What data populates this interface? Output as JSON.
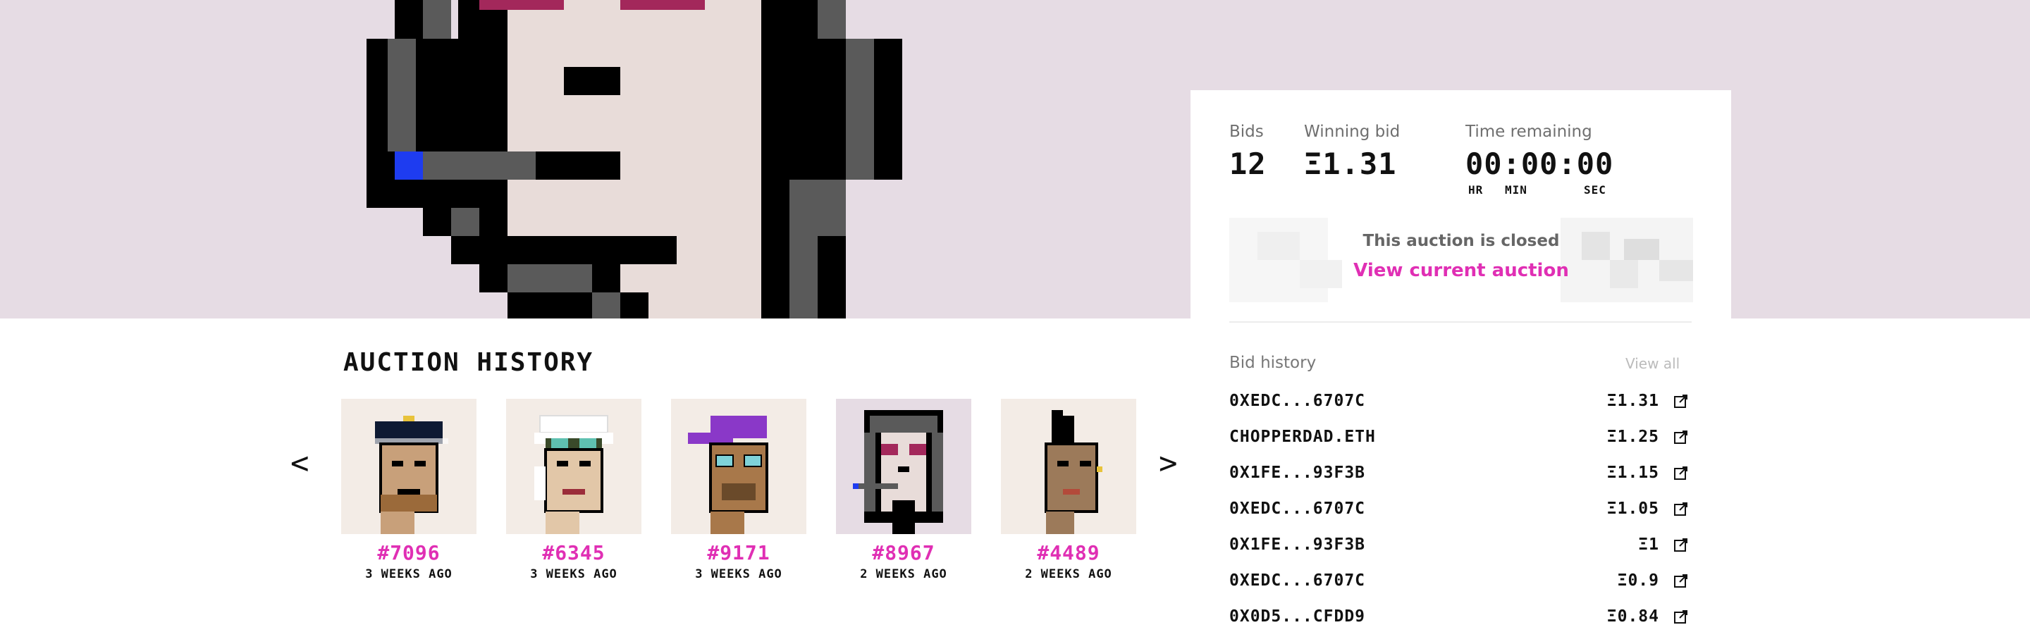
{
  "auction": {
    "bids_label": "Bids",
    "bids_value": "12",
    "winning_label": "Winning bid",
    "winning_value": "Ξ1.31",
    "time_label": "Time remaining",
    "time_value": "00:00:00",
    "units": [
      "HR",
      "MIN",
      "SEC"
    ],
    "closed_text": "This auction is closed",
    "view_current": "View current auction"
  },
  "history": {
    "title": "AUCTION HISTORY",
    "prev_label": "<",
    "next_label": ">",
    "items": [
      {
        "number": "#7096",
        "ago": "3 WEEKS AGO",
        "bg": "#f3ece6"
      },
      {
        "number": "#6345",
        "ago": "3 WEEKS AGO",
        "bg": "#f3ece6"
      },
      {
        "number": "#9171",
        "ago": "3 WEEKS AGO",
        "bg": "#f3ece6"
      },
      {
        "number": "#8967",
        "ago": "2 WEEKS AGO",
        "bg": "#e6dce4"
      },
      {
        "number": "#4489",
        "ago": "2 WEEKS AGO",
        "bg": "#f3ece6"
      }
    ]
  },
  "bid_history": {
    "title": "Bid history",
    "view_all": "View all",
    "bids": [
      {
        "address": "0XEDC...6707C",
        "amount": "Ξ1.31"
      },
      {
        "address": "CHOPPERDAD.ETH",
        "amount": "Ξ1.25"
      },
      {
        "address": "0X1FE...93F3B",
        "amount": "Ξ1.15"
      },
      {
        "address": "0XEDC...6707C",
        "amount": "Ξ1.05"
      },
      {
        "address": "0X1FE...93F3B",
        "amount": "Ξ1"
      },
      {
        "address": "0XEDC...6707C",
        "amount": "Ξ0.9"
      },
      {
        "address": "0X0D5...CFDD9",
        "amount": "Ξ0.84"
      }
    ]
  },
  "colors": {
    "accent": "#e02fb4",
    "hero_bg": "#e6dce4",
    "text": "#111111",
    "muted": "#6f6f6f"
  }
}
